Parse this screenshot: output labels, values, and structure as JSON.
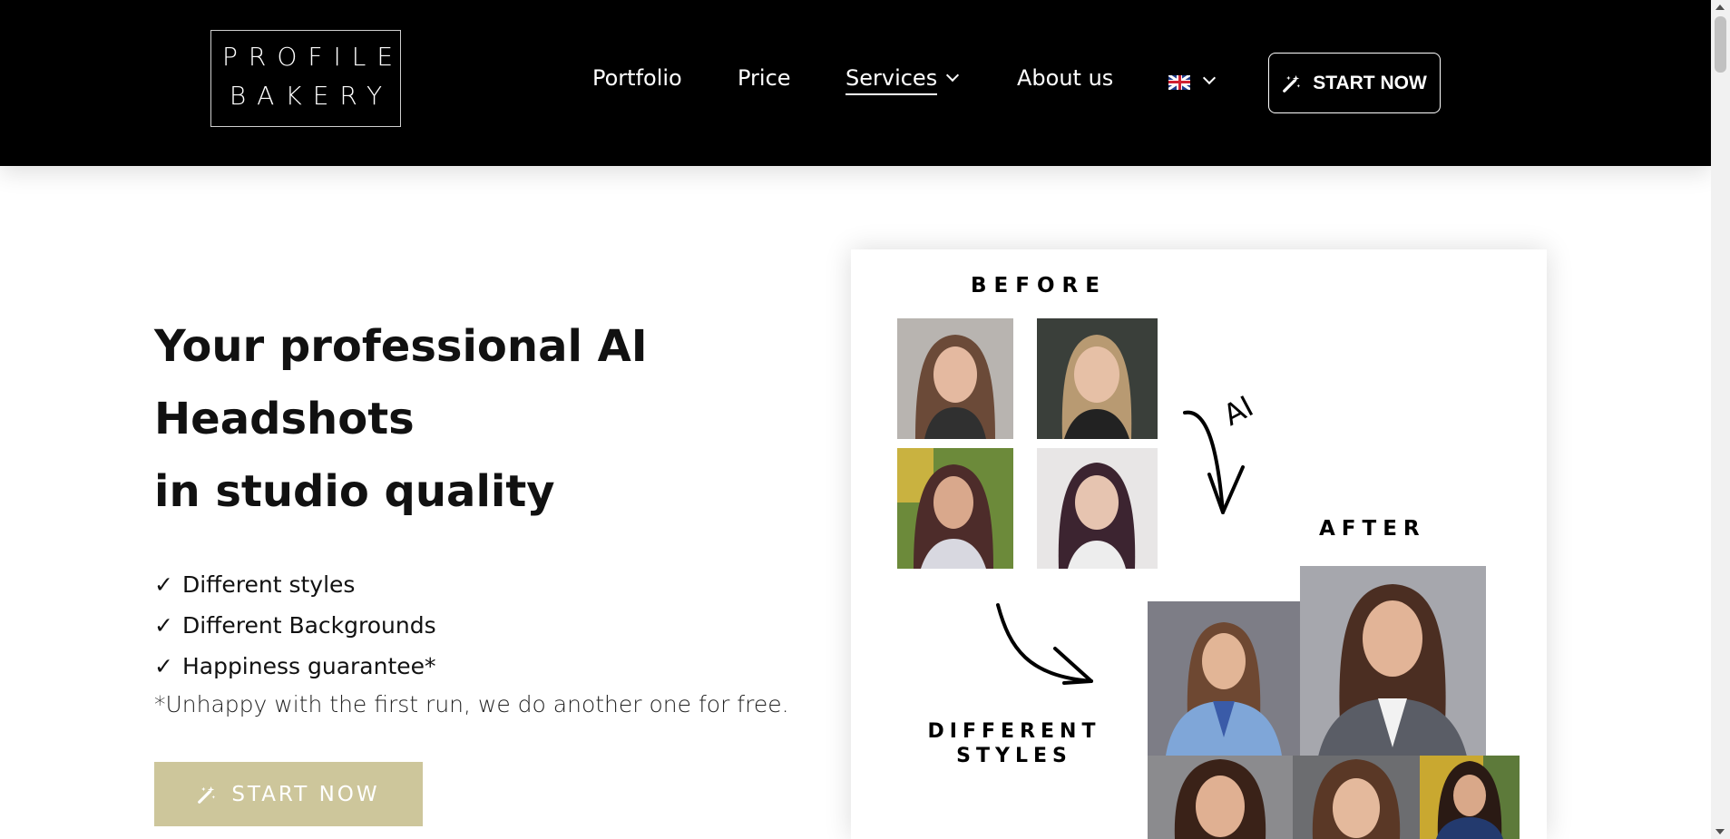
{
  "header": {
    "logo_line1": "PROFILE",
    "logo_line2": "BAKERY",
    "nav": {
      "portfolio": "Portfolio",
      "price": "Price",
      "services": "Services",
      "about": "About us"
    },
    "cta_label": "START NOW"
  },
  "hero": {
    "title_line1": "Your professional AI",
    "title_line2": "Headshots",
    "title_line3": "in studio quality",
    "bullets": [
      {
        "check": "✓",
        "text": "Different styles"
      },
      {
        "check": "✓",
        "text": "Different Backgrounds"
      },
      {
        "check": "✓",
        "text": "Happiness guarantee*"
      }
    ],
    "note": "*Unhappy with the first run, we do another one for free.",
    "cta_label": "START NOW"
  },
  "collage": {
    "before_label": "BEFORE",
    "after_label": "AFTER",
    "ai_label": "AI",
    "styles_label_line1": "DIFFERENT",
    "styles_label_line2": "STYLES"
  },
  "colors": {
    "header_bg": "#000000",
    "cta_gold": "#cdc69b",
    "text": "#111111"
  },
  "icons": {
    "cta_icon": "magic-wand-icon",
    "language_flag": "uk-flag-icon",
    "dropdown": "chevron-down-icon"
  }
}
